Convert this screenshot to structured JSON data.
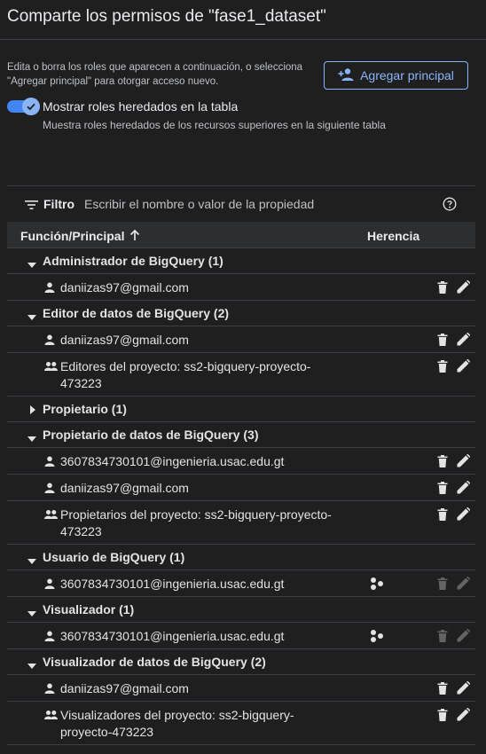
{
  "header": {
    "title": "Comparte los permisos de \"fase1_dataset\""
  },
  "intro": {
    "description": "Edita o borra los roles que aparecen a continuación, o selecciona \"Agregar principal\" para otorgar acceso nuevo.",
    "add_button_label": "Agregar principal"
  },
  "toggle": {
    "label": "Mostrar roles heredados en la tabla",
    "description": "Muestra roles heredados de los recursos superiores en la siguiente tabla",
    "checked": true
  },
  "filter": {
    "label": "Filtro",
    "placeholder": "Escribir el nombre o valor de la propiedad"
  },
  "table": {
    "col_function": "Función/Principal",
    "col_inheritance": "Herencia"
  },
  "groups": [
    {
      "label": "Administrador de BigQuery (1)",
      "expanded": true,
      "members": [
        {
          "name": "daniizas97@gmail.com",
          "type": "person",
          "inherited": false
        }
      ]
    },
    {
      "label": "Editor de datos de BigQuery (2)",
      "expanded": true,
      "members": [
        {
          "name": "daniizas97@gmail.com",
          "type": "person",
          "inherited": false
        },
        {
          "name": "Editores del proyecto: ss2-bigquery-proyecto-473223",
          "type": "group",
          "inherited": false
        }
      ]
    },
    {
      "label": "Propietario (1)",
      "expanded": false,
      "members": []
    },
    {
      "label": "Propietario de datos de BigQuery (3)",
      "expanded": true,
      "members": [
        {
          "name": "3607834730101@ingenieria.usac.edu.gt",
          "type": "person",
          "inherited": false
        },
        {
          "name": "daniizas97@gmail.com",
          "type": "person",
          "inherited": false
        },
        {
          "name": "Propietarios del proyecto: ss2-bigquery-proyecto-473223",
          "type": "group",
          "inherited": false
        }
      ]
    },
    {
      "label": "Usuario de BigQuery (1)",
      "expanded": true,
      "members": [
        {
          "name": "3607834730101@ingenieria.usac.edu.gt",
          "type": "person",
          "inherited": true
        }
      ]
    },
    {
      "label": "Visualizador (1)",
      "expanded": true,
      "members": [
        {
          "name": "3607834730101@ingenieria.usac.edu.gt",
          "type": "person",
          "inherited": true
        }
      ]
    },
    {
      "label": "Visualizador de datos de BigQuery (2)",
      "expanded": true,
      "members": [
        {
          "name": "daniizas97@gmail.com",
          "type": "person",
          "inherited": false
        },
        {
          "name": "Visualizadores del proyecto: ss2-bigquery-proyecto-473223",
          "type": "group",
          "inherited": false
        }
      ]
    }
  ],
  "colors": {
    "background": "#1f1f1f",
    "accent": "#8ab4f8",
    "toggle_track": "#4285f4",
    "text": "#e3e3e3"
  },
  "icons": {
    "add_person": "person-add-icon",
    "filter": "filter-icon",
    "help": "help-icon",
    "sort": "arrow-up-icon",
    "expand": "caret-down-icon",
    "collapse": "caret-right-icon",
    "person": "person-icon",
    "group": "group-icon",
    "inherited": "hierarchy-icon",
    "delete": "trash-icon",
    "edit": "pencil-icon"
  }
}
